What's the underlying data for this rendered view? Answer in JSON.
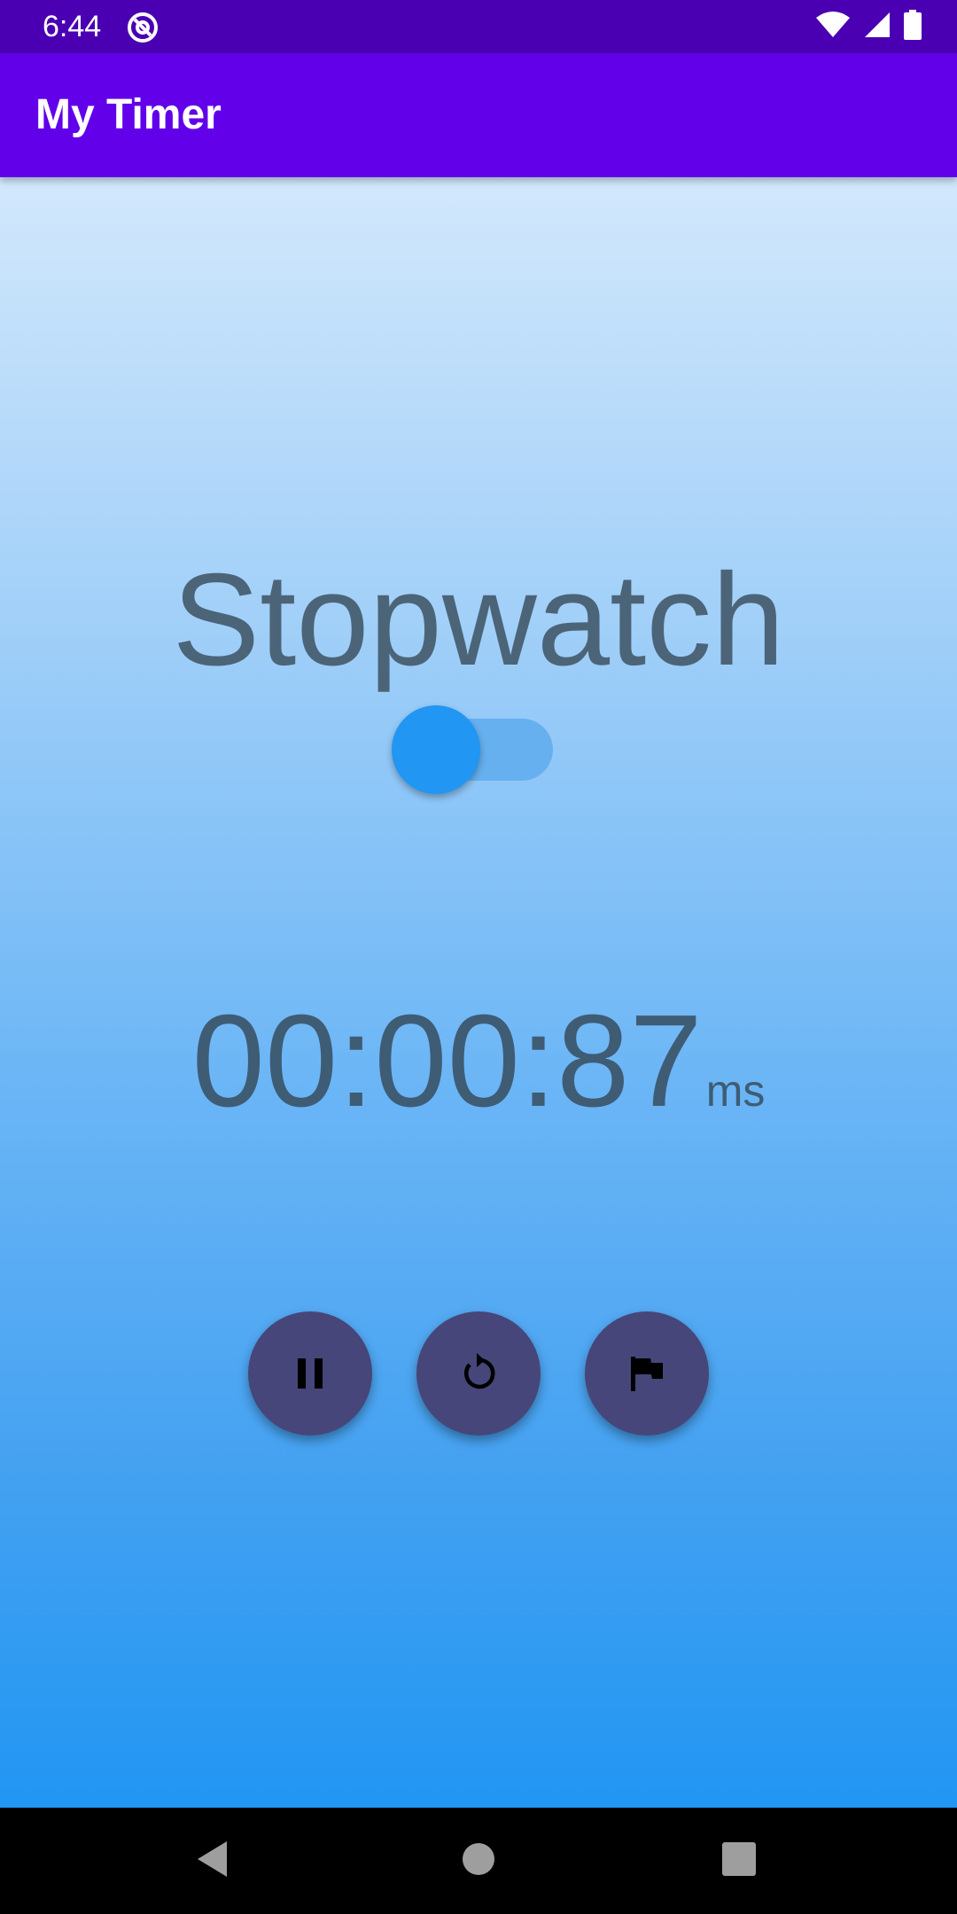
{
  "status_bar": {
    "time": "6:44",
    "background": "#4a00b2"
  },
  "app_bar": {
    "title": "My Timer",
    "background": "#6200ea"
  },
  "main": {
    "mode_label": "Stopwatch",
    "mode_toggle_on": false,
    "time_value": "00:00:87",
    "time_unit": "ms"
  },
  "controls": [
    {
      "icon": "pause-icon"
    },
    {
      "icon": "reset-icon"
    },
    {
      "icon": "flag-icon"
    }
  ],
  "colors": {
    "accent": "#2196f3",
    "fab": "#46467a",
    "text": "#4c6478"
  }
}
